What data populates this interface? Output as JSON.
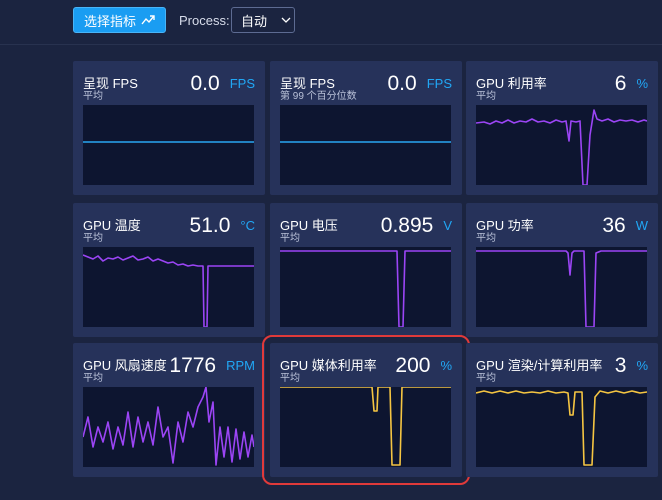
{
  "toolbar": {
    "select_metrics_label": "选择指标",
    "process_label": "Process:",
    "process_value": "自动"
  },
  "cards": [
    {
      "title": "呈现 FPS",
      "subtitle": "平均",
      "value": "0.0",
      "unit": "FPS",
      "line_color": "#2aa6f2"
    },
    {
      "title": "呈现 FPS",
      "subtitle": "第 99 个百分位数",
      "value": "0.0",
      "unit": "FPS",
      "line_color": "#2aa6f2"
    },
    {
      "title": "GPU 利用率",
      "subtitle": "平均",
      "value": "6",
      "unit": "%",
      "line_color": "#9b45f5"
    },
    {
      "title": "GPU 温度",
      "subtitle": "平均",
      "value": "51.0",
      "unit": "°C",
      "line_color": "#9b45f5"
    },
    {
      "title": "GPU 电压",
      "subtitle": "平均",
      "value": "0.895",
      "unit": "V",
      "line_color": "#9b45f5"
    },
    {
      "title": "GPU 功率",
      "subtitle": "平均",
      "value": "36",
      "unit": "W",
      "line_color": "#9b45f5"
    },
    {
      "title": "GPU 风扇速度",
      "subtitle": "平均",
      "value": "1776",
      "unit": "RPM",
      "line_color": "#9b45f5"
    },
    {
      "title": "GPU 媒体利用率",
      "subtitle": "平均",
      "value": "200",
      "unit": "%",
      "line_color": "#f5c542"
    },
    {
      "title": "GPU 渲染/计算利用率",
      "subtitle": "平均",
      "value": "3",
      "unit": "%",
      "line_color": "#f5c542"
    }
  ]
}
